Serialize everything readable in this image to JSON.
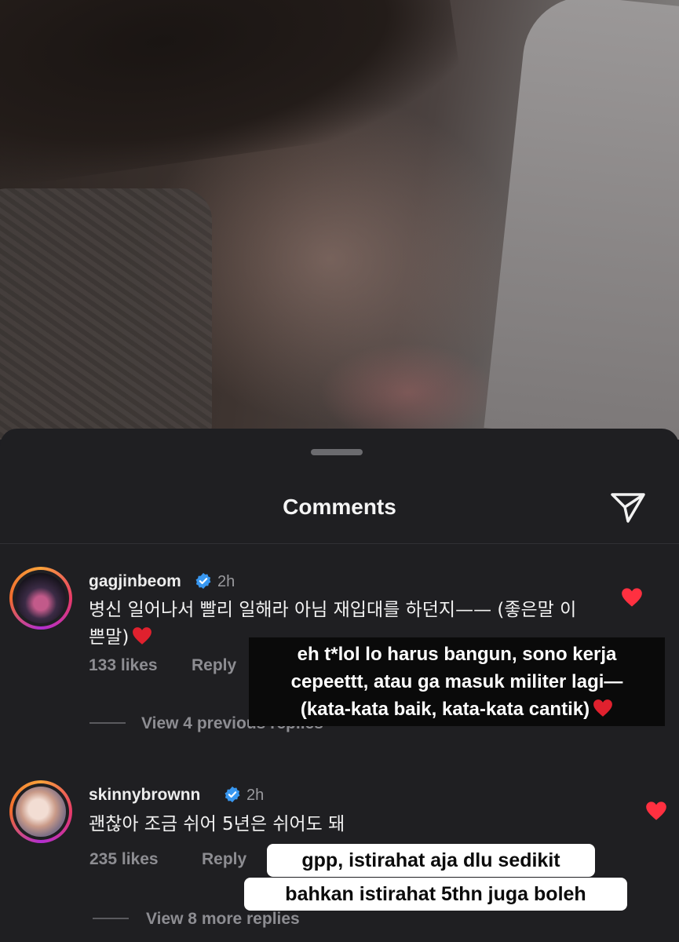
{
  "sheet": {
    "title": "Comments"
  },
  "comments": [
    {
      "username": "gagjinbeom",
      "time": "2h",
      "text": "병신 일어나서 빨리 일해라 아님 재입대를 하던지—— (좋은말 이 쁜말)",
      "likes": "133 likes",
      "reply": "Reply",
      "view_replies": "View 4 previous replies"
    },
    {
      "username": "skinnybrownn",
      "time": "2h",
      "text": "괜찮아 조금 쉬어 5년은 쉬어도 돼",
      "likes": "235 likes",
      "reply": "Reply",
      "view_replies": "View 8 more replies"
    }
  ],
  "captions": {
    "first": [
      "eh t*lol lo harus bangun, sono kerja",
      "cepeettt, atau ga masuk militer lagi—",
      "(kata-kata baik, kata-kata cantik)"
    ],
    "second": [
      "gpp, istirahat aja dlu sedikit",
      "bahkan istirahat 5thn juga boleh"
    ]
  },
  "icons": {
    "share": "paper-plane-icon",
    "verified": "verified-badge-icon",
    "like": "heart-icon"
  },
  "colors": {
    "background": "#1f1f22",
    "like_red": "#ff3040",
    "verified_blue": "#3897f0"
  }
}
